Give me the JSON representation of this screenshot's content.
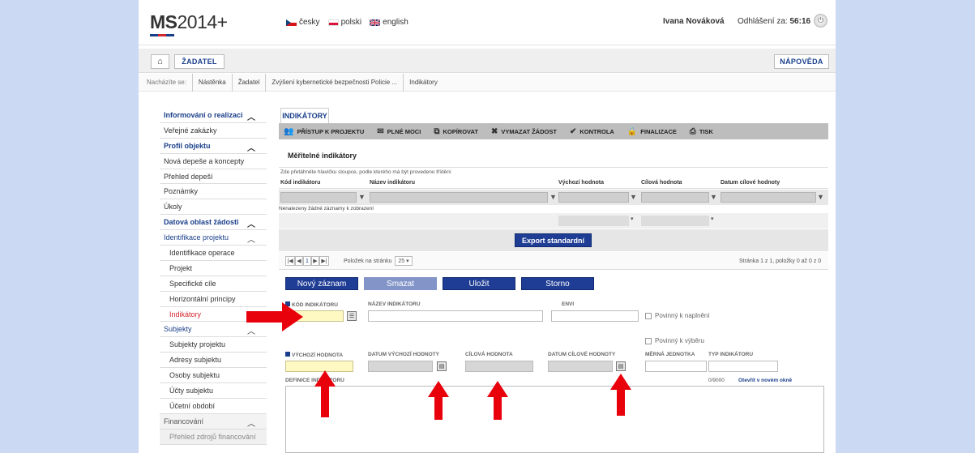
{
  "header": {
    "logo_text": "MS",
    "logo_suffix": "2014+",
    "logo_colors": [
      "#1a3f8a",
      "#d2262d",
      "#1a3f8a"
    ],
    "languages": [
      {
        "label": "česky",
        "flag": "cz-flag-icon"
      },
      {
        "label": "polski",
        "flag": "pl-flag-icon"
      },
      {
        "label": "english",
        "flag": "uk-flag-icon"
      }
    ],
    "user_name": "Ivana Nováková",
    "logout_label": "Odhlášení za:",
    "logout_time": "56:16",
    "power_icon": "power-icon"
  },
  "nav": {
    "home_icon": "home-icon",
    "applicant_label": "ŽADATEL",
    "help_label": "NÁPOVĚDA"
  },
  "breadcrumb": {
    "label": "Nacházíte se:",
    "items": [
      "Nástěnka",
      "Žadatel",
      "Zvýšení kybernetické bezpečnosti Policie ...",
      "Indikátory"
    ]
  },
  "sidebar": {
    "items": [
      {
        "label": "Informování o realizaci",
        "type": "head",
        "chevron": true
      },
      {
        "label": "Veřejné zakázky",
        "type": "plain"
      },
      {
        "label": "Profil objektu",
        "type": "head",
        "chevron": true
      },
      {
        "label": "Nová depeše a koncepty",
        "type": "plain"
      },
      {
        "label": "Přehled depeší",
        "type": "plain"
      },
      {
        "label": "Poznámky",
        "type": "plain"
      },
      {
        "label": "Úkoly",
        "type": "plain"
      },
      {
        "label": "Datová oblast žádosti",
        "type": "head",
        "chevron": true
      },
      {
        "label": "Identifikace projektu",
        "type": "head-sub",
        "chevron": true
      },
      {
        "label": "Identifikace operace",
        "type": "child"
      },
      {
        "label": "Projekt",
        "type": "child"
      },
      {
        "label": "Specifické cíle",
        "type": "child"
      },
      {
        "label": "Horizontální principy",
        "type": "child"
      },
      {
        "label": "Indikátory",
        "type": "child-active"
      },
      {
        "label": "Subjekty",
        "type": "head-sub",
        "chevron": true
      },
      {
        "label": "Subjekty projektu",
        "type": "child"
      },
      {
        "label": "Adresy subjektu",
        "type": "child"
      },
      {
        "label": "Osoby subjektu",
        "type": "child"
      },
      {
        "label": "Účty subjektu",
        "type": "child"
      },
      {
        "label": "Účetní období",
        "type": "child"
      },
      {
        "label": "Financování",
        "type": "head-sub",
        "chevron": true
      },
      {
        "label": "Přehled zdrojů financování",
        "type": "muted"
      }
    ]
  },
  "main": {
    "tab_label": "INDIKÁTORY",
    "toolbar": [
      {
        "label": "PŘÍSTUP K PROJEKTU",
        "icon": "people-icon",
        "glyph": "👥"
      },
      {
        "label": "PLNÉ MOCI",
        "icon": "envelope-icon",
        "glyph": "✉"
      },
      {
        "label": "KOPÍROVAT",
        "icon": "copy-icon",
        "glyph": "⧉"
      },
      {
        "label": "VYMAZAT ŽÁDOST",
        "icon": "delete-icon",
        "glyph": "✖"
      },
      {
        "label": "KONTROLA",
        "icon": "check-icon",
        "glyph": "✔"
      },
      {
        "label": "FINALIZACE",
        "icon": "lock-icon",
        "glyph": "🔒"
      },
      {
        "label": "TISK",
        "icon": "print-icon",
        "glyph": "⎙"
      }
    ],
    "section_title": "Měřitelné indikátory",
    "grid_hint": "Zde přetáhněte hlavičku sloupce, podle kterého má být provedeno třídění",
    "columns": [
      "Kód indikátoru",
      "Název indikátoru",
      "Výchozí hodnota",
      "Cílová hodnota",
      "Datum cílové hodnoty"
    ],
    "empty_message": "Nenalezeny žádné záznamy k zobrazení",
    "export_label": "Export standardní",
    "pager": {
      "first": "|◀",
      "prev": "◀",
      "page": "1",
      "next": "▶",
      "last": "▶|",
      "per_page_label": "Položek na stránku",
      "per_page_value": "25",
      "summary": "Stránka 1 z 1, položky 0 až 0 z 0"
    },
    "actions": [
      {
        "label": "Nový záznam",
        "enabled": true
      },
      {
        "label": "Smazat",
        "enabled": false
      },
      {
        "label": "Uložit",
        "enabled": true
      },
      {
        "label": "Storno",
        "enabled": true
      }
    ],
    "form": {
      "code_label": "KÓD INDIKÁTORU",
      "name_label": "NÁZEV INDIKÁTORU",
      "envi_label": "ENVI",
      "mandatory_fulfil": "Povinný k naplnění",
      "mandatory_select": "Povinný k výběru",
      "start_value_label": "VÝCHOZÍ HODNOTA",
      "start_date_label": "DATUM VÝCHOZÍ HODNOTY",
      "target_value_label": "CÍLOVÁ HODNOTA",
      "target_date_label": "DATUM CÍLOVÉ HODNOTY",
      "unit_label": "MĚRNÁ JEDNOTKA",
      "type_label": "TYP INDIKÁTORU",
      "definition_label": "DEFINICE INDIKÁTORU",
      "char_counter": "0/9000",
      "open_new_window": "Otevřít v novém okně"
    }
  },
  "annotation_color": "#e8000b"
}
